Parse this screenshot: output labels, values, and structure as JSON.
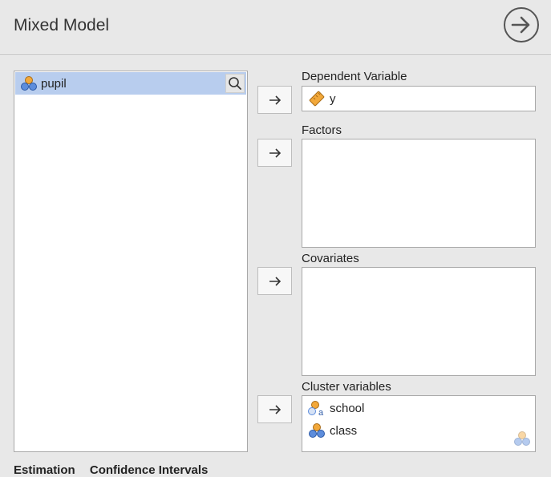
{
  "window": {
    "title": "Mixed Model"
  },
  "variables": {
    "items": [
      {
        "label": "pupil",
        "icon": "nominal-variable-icon"
      }
    ]
  },
  "boxes": {
    "dependent": {
      "label": "Dependent Variable",
      "items": [
        {
          "label": "y",
          "icon": "scale-variable-icon"
        }
      ]
    },
    "factors": {
      "label": "Factors",
      "items": []
    },
    "covariates": {
      "label": "Covariates",
      "items": []
    },
    "cluster": {
      "label": "Cluster variables",
      "items": [
        {
          "label": "school",
          "icon": "nominal-text-variable-icon"
        },
        {
          "label": "class",
          "icon": "nominal-variable-icon"
        }
      ]
    }
  },
  "footer": {
    "tab1": "Estimation",
    "tab2": "Confidence Intervals"
  },
  "colors": {
    "selected_row": "#b8cdee",
    "background": "#e8e8e8",
    "ruler": "#f2a83a"
  }
}
